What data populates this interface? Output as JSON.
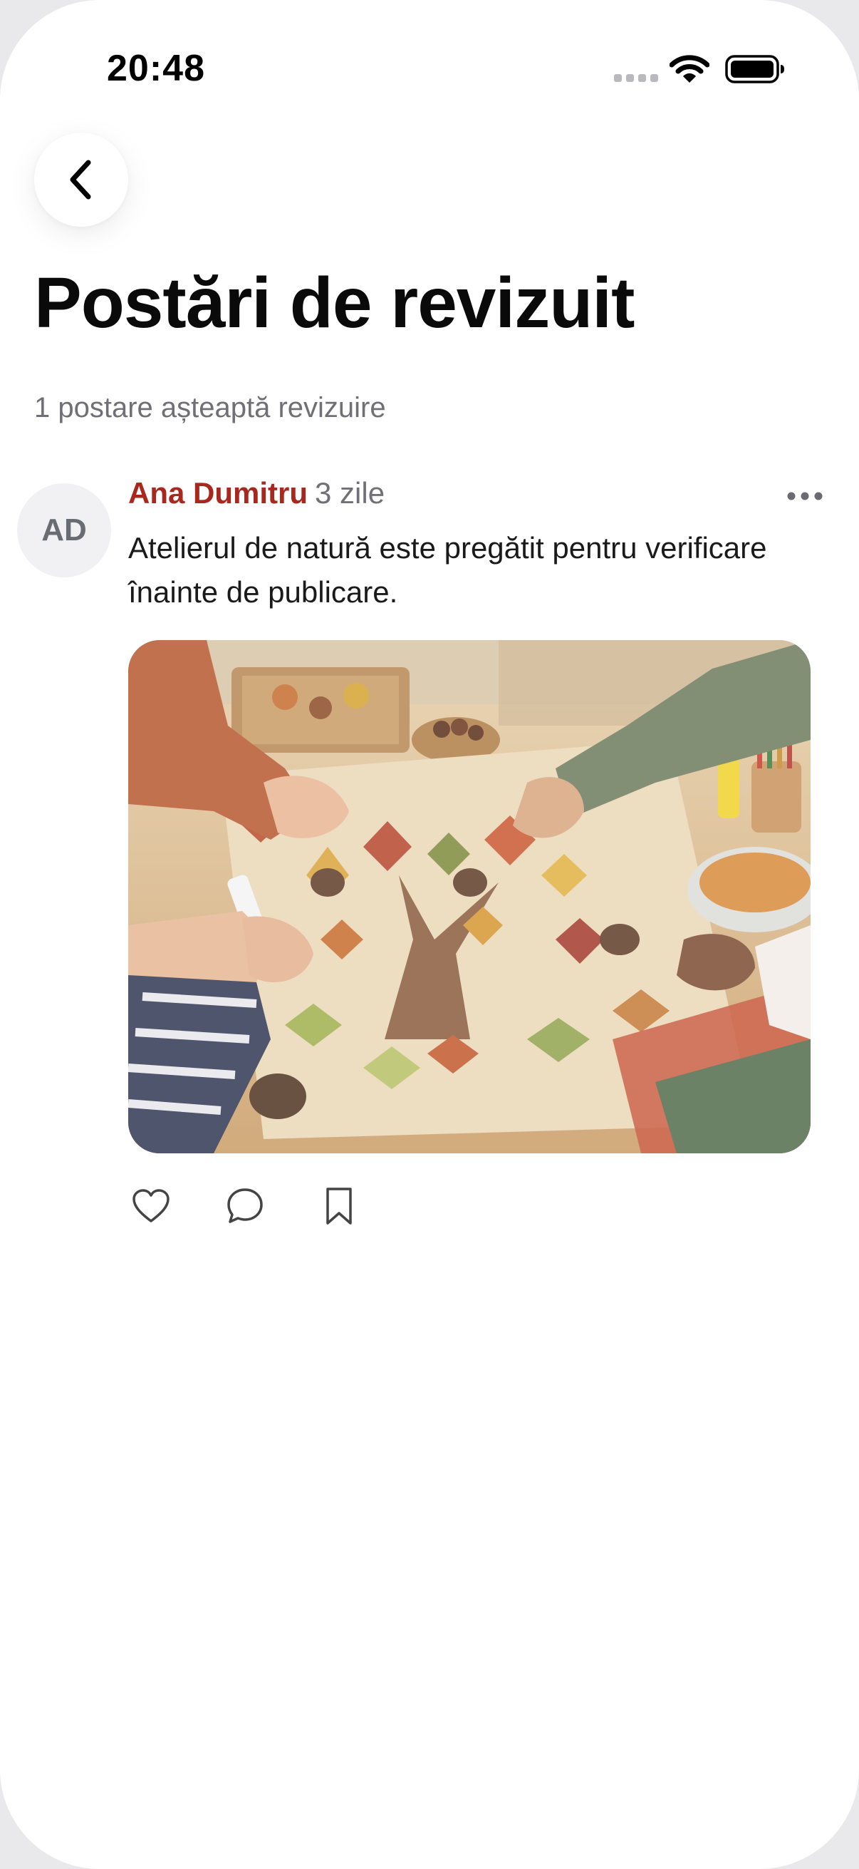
{
  "status_bar": {
    "time": "20:48",
    "icons": [
      "cellular-signal-icon",
      "wifi-icon",
      "battery-icon"
    ]
  },
  "navigation": {
    "back_icon": "chevron-left-icon"
  },
  "page": {
    "title": "Postări de revizuit",
    "subtitle": "1 postare așteaptă revizuire"
  },
  "post": {
    "avatar_initials": "AD",
    "author": "Ana Dumitru",
    "time": "3 zile",
    "text": "Atelierul de natură este pregătit pentru verificare înainte de publicare.",
    "image_subject": "autumn-leaf-tree-collage-photo",
    "more_icon": "ellipsis-icon",
    "actions": [
      "heart-icon",
      "comment-icon",
      "bookmark-icon"
    ]
  },
  "colors": {
    "accent_author": "#a8281d",
    "title": "#0a0a0a",
    "secondary_text": "#6f6f75",
    "background": "#ffffff"
  }
}
